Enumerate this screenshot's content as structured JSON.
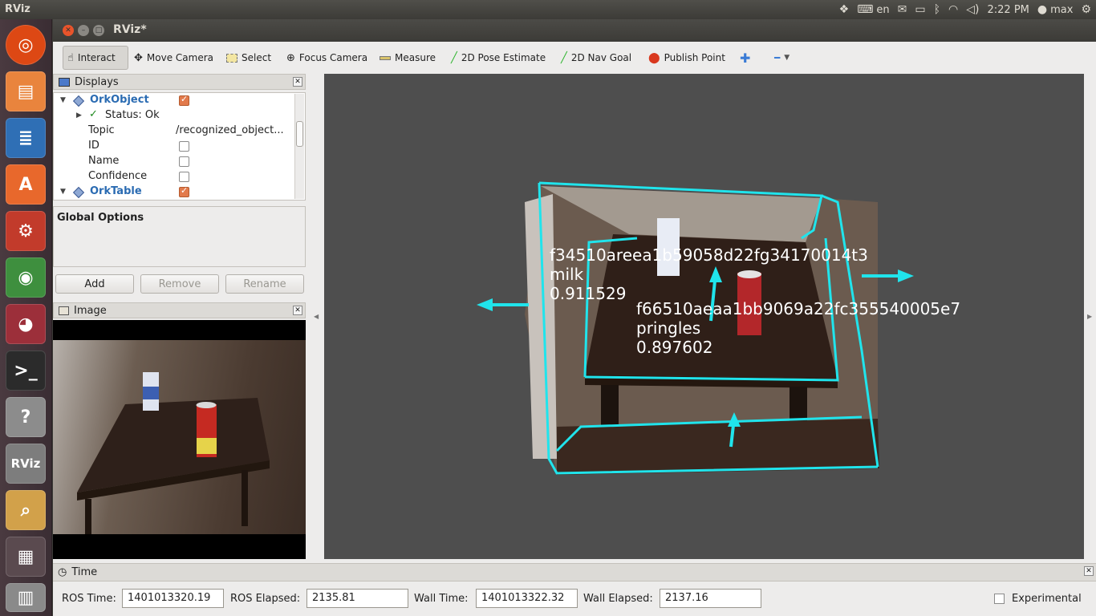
{
  "system": {
    "app_name": "RViz",
    "keyboard": "en",
    "time": "2:22 PM",
    "user": "max"
  },
  "window": {
    "title": "RViz*"
  },
  "toolbar": {
    "interact": "Interact",
    "move_camera": "Move Camera",
    "select": "Select",
    "focus_camera": "Focus Camera",
    "measure": "Measure",
    "pose_estimate": "2D Pose Estimate",
    "nav_goal": "2D Nav Goal",
    "publish_point": "Publish Point"
  },
  "displays": {
    "title": "Displays",
    "orkobject": "OrkObject",
    "status": "Status: Ok",
    "topic_label": "Topic",
    "topic_value": "/recognized_object...",
    "id_label": "ID",
    "name_label": "Name",
    "confidence_label": "Confidence",
    "orktable": "OrkTable",
    "global_options": "Global Options",
    "add": "Add",
    "remove": "Remove",
    "rename": "Rename"
  },
  "image_panel": {
    "title": "Image"
  },
  "view": {
    "obj1": {
      "id": "f34510areea1b59058d22fg34170014t3",
      "name": "milk",
      "confidence": "0.911529"
    },
    "obj2": {
      "id": "f66510aeaa1bb9069a22fc355540005e7",
      "name": "pringles",
      "confidence": "0.897602"
    },
    "colors": {
      "marker": "#20e4ec",
      "background": "#4e4e4e"
    }
  },
  "time_panel": {
    "title": "Time",
    "ros_time_label": "ROS Time:",
    "ros_time": "1401013320.19",
    "ros_elapsed_label": "ROS Elapsed:",
    "ros_elapsed": "2135.81",
    "wall_time_label": "Wall Time:",
    "wall_time": "1401013322.32",
    "wall_elapsed_label": "Wall Elapsed:",
    "wall_elapsed": "2137.16",
    "experimental": "Experimental"
  }
}
